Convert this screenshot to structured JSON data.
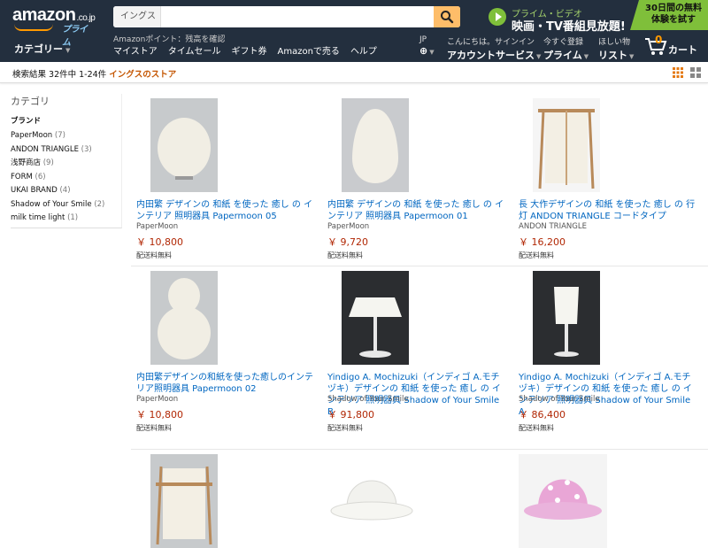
{
  "header": {
    "logo": "amazon",
    "logo_suffix": ".co.jp",
    "logo_prime": "プライム",
    "search_category": "イングス",
    "search_value": "",
    "promo_line1": "プライム・ビデオ",
    "promo_line2": "映画・TV番組見放題!",
    "trial_text": "30日間の無料体験を試す",
    "categories_label": "カテゴリー",
    "points_text": "Amazonポイント：残高を確認",
    "subnav": [
      "マイストア",
      "タイムセール",
      "ギフト券",
      "Amazonで売る",
      "ヘルプ"
    ],
    "lang_small": "JP",
    "account_small": "こんにちは。サインイン",
    "account_big": "アカウントサービス",
    "prime_small": "今すぐ登録",
    "prime_big": "プライム",
    "list_small": "ほしい物",
    "list_big": "リスト",
    "cart_count": "0",
    "cart_label": "カート"
  },
  "results": {
    "summary": "検索結果 32件中 1-24件",
    "store": "イングスのストア"
  },
  "sidebar": {
    "title": "カテゴリ",
    "brand_heading": "ブランド",
    "brands": [
      {
        "name": "PaperMoon",
        "count": "(7)"
      },
      {
        "name": "ANDON TRIANGLE",
        "count": "(3)"
      },
      {
        "name": "浅野商店",
        "count": "(9)"
      },
      {
        "name": "FORM",
        "count": "(6)"
      },
      {
        "name": "UKAI BRAND",
        "count": "(4)"
      },
      {
        "name": "Shadow of Your Smile",
        "count": "(2)"
      },
      {
        "name": "milk time light",
        "count": "(1)"
      }
    ]
  },
  "products": [
    {
      "title": "内田繁 デザインの 和紙 を使った 癒し の インテリア 照明器具 Papermoon 05",
      "brand": "PaperMoon",
      "price": "￥ 10,800",
      "shipping": "配送料無料",
      "icon": "round-paper-lamp"
    },
    {
      "title": "内田繁 デザインの 和紙 を使った 癒し の インテリア 照明器具 Papermoon 01",
      "brand": "PaperMoon",
      "price": "￥ 9,720",
      "shipping": "配送料無料",
      "icon": "egg-paper-lamp"
    },
    {
      "title": "長 大作デザインの 和紙 を使った 癒し の 行灯 ANDON TRIANGLE コードタイプ",
      "brand": "ANDON TRIANGLE",
      "price": "￥ 16,200",
      "shipping": "配送料無料",
      "icon": "andon-lamp"
    },
    {
      "title": "内田繁デザインの和紙を使った癒しのインテリア照明器具 Papermoon 02",
      "brand": "PaperMoon",
      "price": "￥ 10,800",
      "shipping": "配送料無料",
      "icon": "gourd-paper-lamp"
    },
    {
      "title": "Yindigo A. Mochizuki（インディゴ A.モチヅキ）デザインの 和紙 を使った 癒し の インテリア 照明器具 Shadow of Your Smile B",
      "brand": "Shadow of Your Smile",
      "price": "￥ 91,800",
      "shipping": "配送料無料",
      "icon": "mushroom-table-lamp"
    },
    {
      "title": "Yindigo A. Mochizuki（インディゴ A.モチヅキ）デザインの 和紙 を使った 癒し の インテリア 照明器具 Shadow of Your Smile A",
      "brand": "Shadow of Your Smile",
      "price": "￥ 86,400",
      "shipping": "配送料無料",
      "icon": "tall-table-lamp"
    },
    {
      "icon": "andon-lamp"
    },
    {
      "icon": "white-hat-shade"
    },
    {
      "icon": "pink-hat-shade"
    }
  ],
  "colors": {
    "header_bg": "#232f3e",
    "link": "#0066c0",
    "price": "#b12704",
    "store": "#c45500",
    "accent": "#febd69"
  }
}
